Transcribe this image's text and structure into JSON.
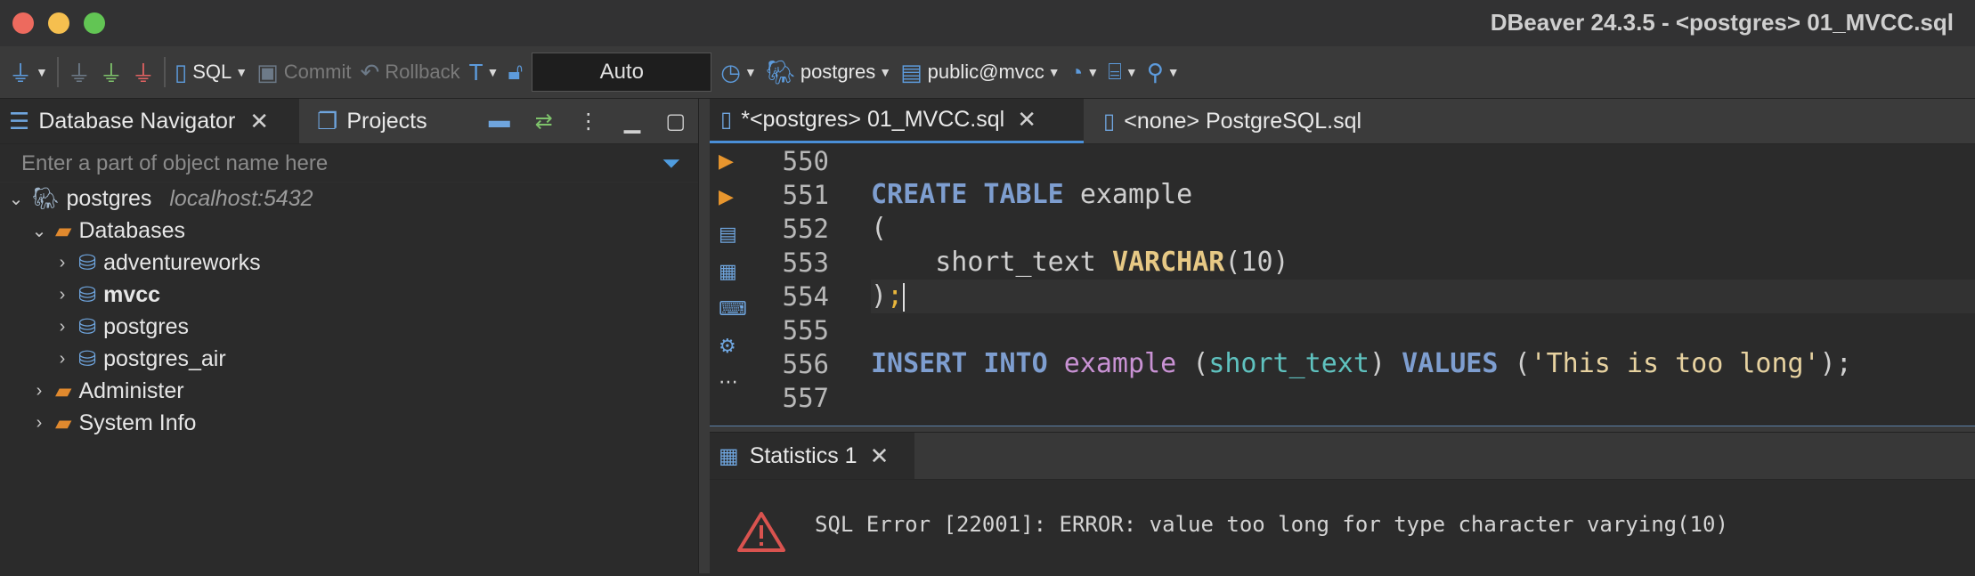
{
  "window": {
    "title": "DBeaver 24.3.5 - <postgres> 01_MVCC.sql"
  },
  "toolbar": {
    "sql_label": "SQL",
    "commit_label": "Commit",
    "rollback_label": "Rollback",
    "transaction_mode": "Auto",
    "datasource_label": "postgres",
    "schema_label": "public@mvcc"
  },
  "navigator": {
    "tab_label": "Database Navigator",
    "projects_tab_label": "Projects",
    "filter_placeholder": "Enter a part of object name here",
    "connection": {
      "name": "postgres",
      "host": "localhost:5432"
    },
    "databases_label": "Databases",
    "databases": [
      "adventureworks",
      "mvcc",
      "postgres",
      "postgres_air"
    ],
    "administer_label": "Administer",
    "system_info_label": "System Info"
  },
  "editor": {
    "tabs": [
      {
        "label": "*<postgres> 01_MVCC.sql"
      },
      {
        "label": "<none> PostgreSQL.sql"
      }
    ],
    "line_numbers": [
      "550",
      "551",
      "552",
      "553",
      "554",
      "555",
      "556",
      "557"
    ],
    "code": {
      "l551_kw": "CREATE TABLE",
      "l551_name": "example",
      "l552": "(",
      "l553_col": "short_text",
      "l553_type": "VARCHAR",
      "l553_args": "(10)",
      "l554_paren": ")",
      "l554_semi": ";",
      "l556_kw1": "INSERT INTO",
      "l556_table": "example",
      "l556_open": "(",
      "l556_col": "short_text",
      "l556_close": ")",
      "l556_kw2": "VALUES",
      "l556_paren_open": "(",
      "l556_string": "'This is too long'",
      "l556_end": ");"
    }
  },
  "results": {
    "tab_label": "Statistics 1",
    "error_message": "SQL Error [22001]: ERROR: value too long for type character varying(10)"
  },
  "colors": {
    "keyword": "#7e9ed0",
    "type": "#e7c985",
    "table": "#c992d4",
    "column": "#5fc2bf",
    "string": "#e7d2a0",
    "error_icon": "#d9534f"
  }
}
